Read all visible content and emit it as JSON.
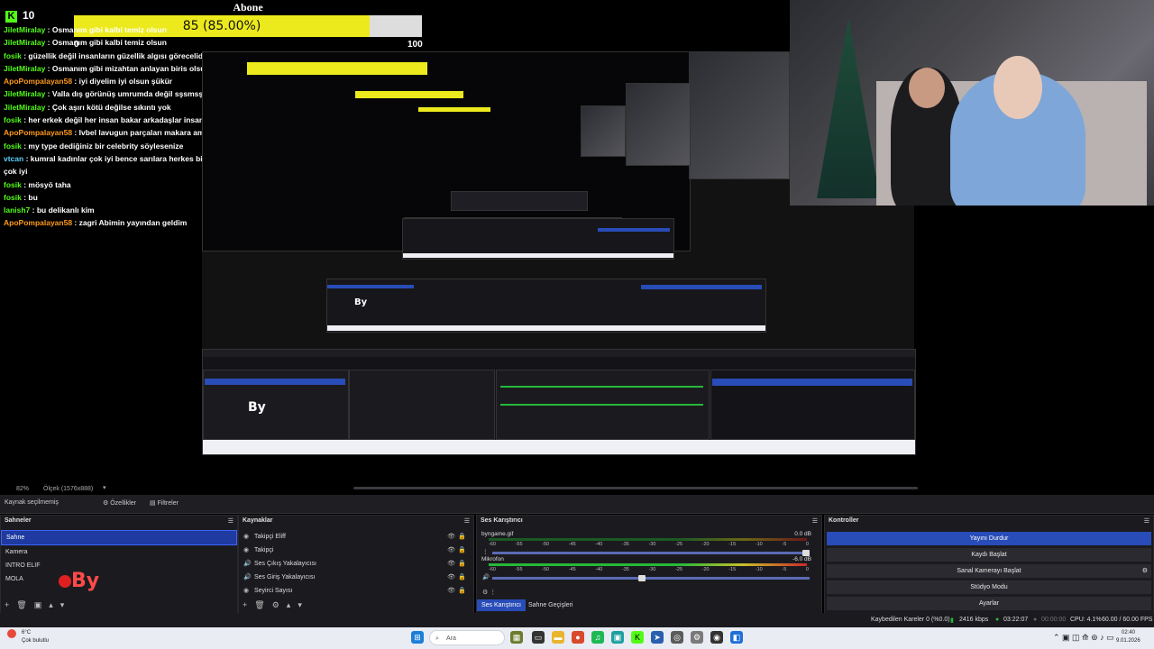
{
  "overlay": {
    "goal_title": "Abone Hedefi",
    "goal_text": "85 (85.00%)",
    "goal_progress": 0.85,
    "goal_min": "0",
    "goal_max": "100",
    "viewer_count": "10",
    "viewer_icon": "kick-icon"
  },
  "chat": [
    {
      "user": "JiletMiralay",
      "msg": " : Osmanım gibi kalbi temiz olsun",
      "color": "green"
    },
    {
      "user": "JiletMiralay",
      "msg": " : Osmanım gibi kalbi temiz olsun",
      "color": "green"
    },
    {
      "user": "fosik",
      "msg": " : güzellik değil insanların güzellik algısı görecelidir",
      "color": "green"
    },
    {
      "user": "JiletMiralay",
      "msg": " : Osmanım gibi mizahtan anlayan biris olsun",
      "color": "green"
    },
    {
      "user": "ApoPompalayan58",
      "msg": " : iyi diyelim iyi olsun şükür",
      "color": "orange"
    },
    {
      "user": "JiletMiralay",
      "msg": " : Valla dış görünüş umrumda değil sşsmsşksşksks",
      "color": "green"
    },
    {
      "user": "JiletMiralay",
      "msg": " : Çok aşırı kötü değilse sıkıntı yok",
      "color": "green"
    },
    {
      "user": "fosik",
      "msg": " : her erkek değil her insan bakar arkadaşlar insanoğluyuz görsel varlıklarız",
      "color": "green"
    },
    {
      "user": "ApoPompalayan58",
      "msg": " : Ivbel lavugun parçaları makara ama kendisi daf arat",
      "color": "orange"
    },
    {
      "user": "fosik",
      "msg": " : my type dediğiniz bir celebrity söylesenize",
      "color": "green"
    },
    {
      "user": "vtcan",
      "msg": " : kumral kadınlar çok iyi bence sarılara herkes biter kumral farkı bence",
      "color": "cyan"
    },
    {
      "user": "",
      "msg": "çok iyi",
      "color": "white"
    },
    {
      "user": "fosik",
      "msg": " : mösyö taha",
      "color": "green"
    },
    {
      "user": "fosik",
      "msg": " : bu",
      "color": "green"
    },
    {
      "user": "lanish7",
      "msg": " : bu delikanlı kim",
      "color": "green"
    },
    {
      "user": "ApoPompalayan58",
      "msg": " : zagri Abimin yayından geldim",
      "color": "orange"
    }
  ],
  "preview": {
    "zoom": "82%",
    "scale": "Ölçek (1576x888)"
  },
  "toolbar": {
    "source_selected": "Kaynak seçilmemiş",
    "properties": "Özellikler",
    "filters": "Filtreler"
  },
  "scenes": {
    "title": "Sahneler",
    "items": [
      "Sahne",
      "Kamera",
      "INTRO ELIF",
      "MOLA"
    ],
    "selected": 0,
    "logo_text": "By"
  },
  "sources": {
    "title": "Kaynaklar",
    "items": [
      {
        "label": "Takipçi Eliff",
        "icon": "browser-icon"
      },
      {
        "label": "Takipçi",
        "icon": "browser-icon"
      },
      {
        "label": "Ses Çıkış Yakalayıcısı",
        "icon": "speaker-icon"
      },
      {
        "label": "Ses Giriş Yakalayıcısı",
        "icon": "speaker-icon"
      },
      {
        "label": "Seyirci Sayısı",
        "icon": "browser-icon"
      }
    ]
  },
  "mixer": {
    "title": "Ses Karıştırıcı",
    "tracks": [
      {
        "name": "byngame.gif",
        "db": "0.0 dB",
        "level": 0.0
      },
      {
        "name": "Mikrofon",
        "db": "-6.0 dB",
        "level": 0.53
      }
    ],
    "scale": [
      "-60",
      "-55",
      "-50",
      "-45",
      "-40",
      "-35",
      "-30",
      "-25",
      "-20",
      "-15",
      "-10",
      "-5",
      "0"
    ],
    "tabs": [
      "Ses Karıştırıcı",
      "Sahne Geçişleri"
    ]
  },
  "controls": {
    "title": "Kontroller",
    "buttons": [
      "Yayını Durdur",
      "Kaydı Başlat",
      "Sanal Kamerayı Başlat",
      "Stüdyo Modu",
      "Ayarlar"
    ]
  },
  "status": {
    "dropped": "Kaybedilen Kareler 0 (%0.0)",
    "bitrate": "2416 kbps",
    "stream_time": "03:22:07",
    "rec_time": "00:00:00",
    "cpu": "CPU: 4.1%",
    "fps": "60.00 / 60.00 FPS"
  },
  "taskbar": {
    "weather_temp": "6°C",
    "weather_desc": "Çok bulutlu",
    "search": "Ara",
    "time": "02:40",
    "date": "9.01.2026"
  },
  "colors": {
    "accent": "#284cb8",
    "goal_bar": "#ecea1c",
    "kick_green": "#53fc18"
  }
}
